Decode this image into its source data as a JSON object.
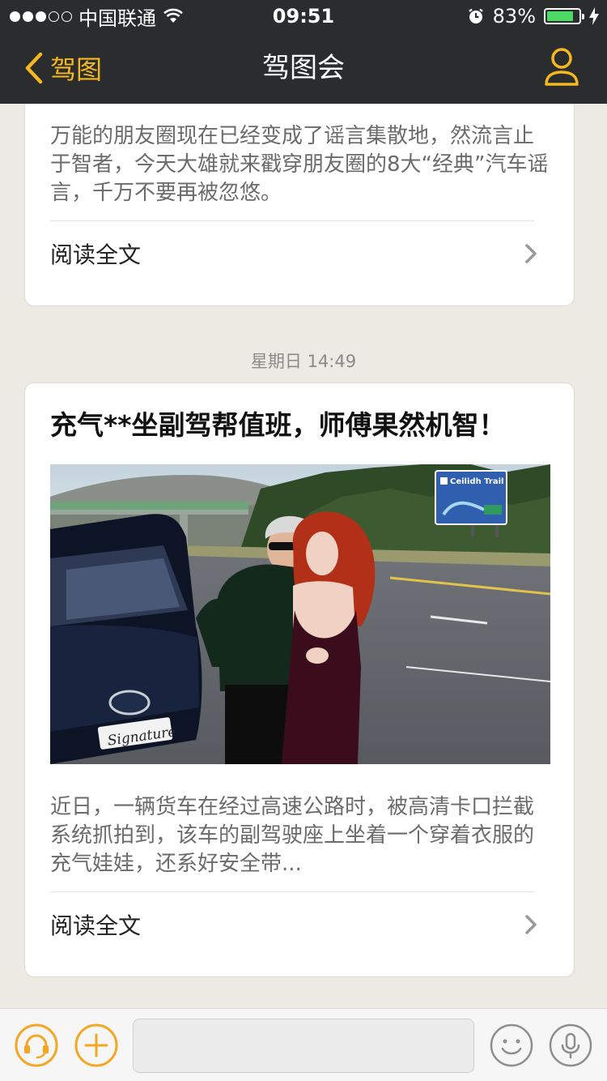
{
  "status_bar": {
    "carrier": "中国联通",
    "time": "09:51",
    "battery_percent": "83%",
    "battery_level": 0.83,
    "signal_bars_filled": 3,
    "signal_bars_total": 5
  },
  "nav": {
    "back_label": "驾图",
    "title": "驾图会",
    "accent_color": "#f5b820"
  },
  "feed": {
    "card1": {
      "summary": "万能的朋友圈现在已经变成了谣言集散地，然流言止于智者，今天大雄就来戳穿朋友圈的8大“经典”汽车谣言，千万不要再被忽悠。",
      "read_more": "阅读全文"
    },
    "timestamp": "星期日 14:49",
    "card2": {
      "title": "充气**坐副驾帮值班，师傅果然机智！",
      "image_sign_text": "Ceilidh Trail",
      "image_plate_text": "Signature",
      "summary": "近日，一辆货车在经过高速公路时，被高清卡口拦截系统抓拍到，该车的副驾驶座上坐着一个穿着衣服的充气娃娃，还系好安全带...",
      "read_more": "阅读全文"
    }
  },
  "bottom_bar": {
    "input_placeholder": "",
    "icons": [
      "headset-icon",
      "plus-icon",
      "emoji-icon",
      "microphone-icon"
    ]
  }
}
